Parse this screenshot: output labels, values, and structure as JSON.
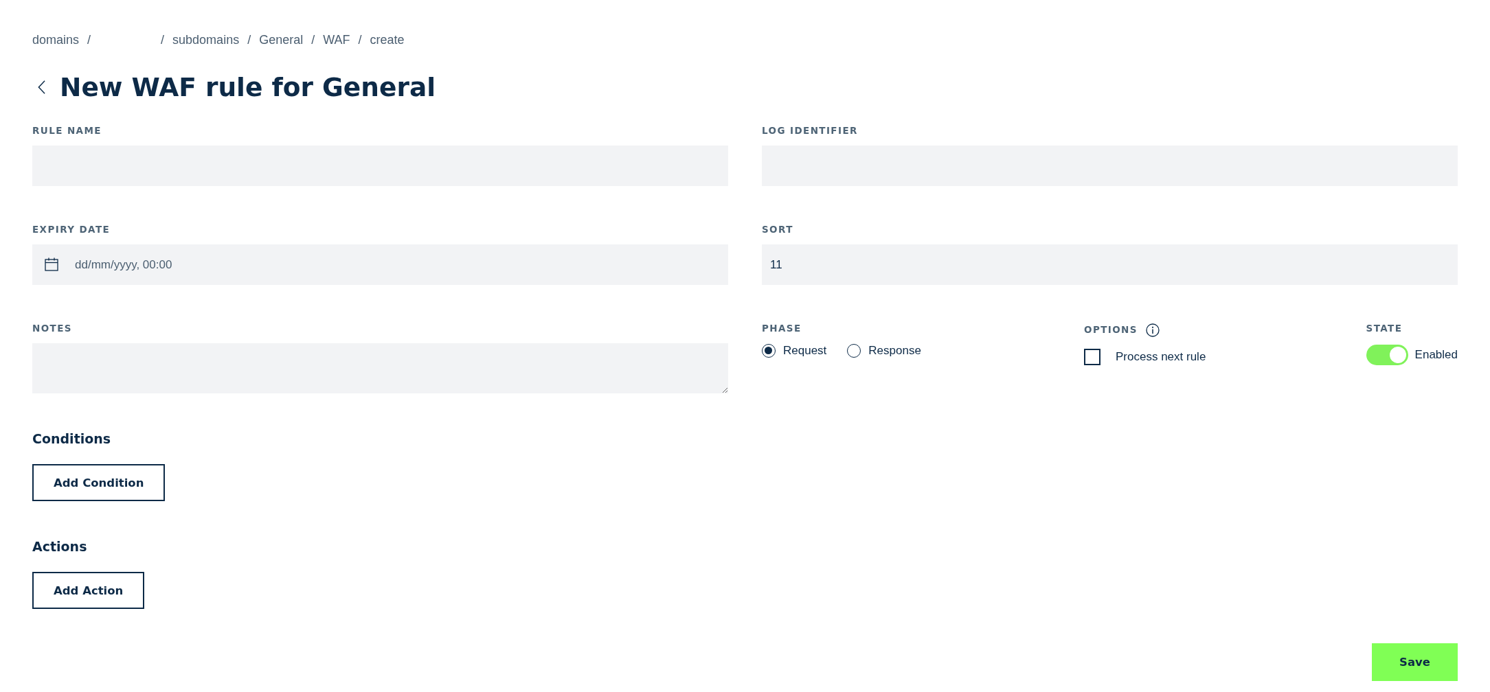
{
  "breadcrumb": {
    "separator": "/",
    "items": [
      {
        "kind": "link",
        "label": "domains"
      },
      {
        "kind": "blank"
      },
      {
        "kind": "link",
        "label": "subdomains"
      },
      {
        "kind": "link",
        "label": "General"
      },
      {
        "kind": "link",
        "label": "WAF"
      },
      {
        "kind": "link",
        "label": "create"
      }
    ]
  },
  "title": "New WAF rule for General",
  "form": {
    "rule_name": {
      "label": "RULE NAME"
    },
    "log_identifier": {
      "label": "LOG IDENTIFIER"
    },
    "expiry_date": {
      "label": "EXPIRY DATE",
      "placeholder": "dd/mm/yyyy, 00:00"
    },
    "sort": {
      "label": "SORT",
      "value": "11"
    },
    "notes": {
      "label": "NOTES"
    },
    "phase": {
      "label": "PHASE",
      "options": [
        {
          "label": "Request",
          "selected": true
        },
        {
          "label": "Response",
          "selected": false
        }
      ]
    },
    "options": {
      "label": "OPTIONS",
      "items": [
        {
          "label": "Process next rule",
          "checked": false
        }
      ]
    },
    "state": {
      "label": "STATE",
      "on": true,
      "text": "Enabled"
    }
  },
  "conditions": {
    "heading": "Conditions",
    "button": "Add Condition"
  },
  "actions": {
    "heading": "Actions",
    "button": "Add Action"
  },
  "save_button": "Save"
}
